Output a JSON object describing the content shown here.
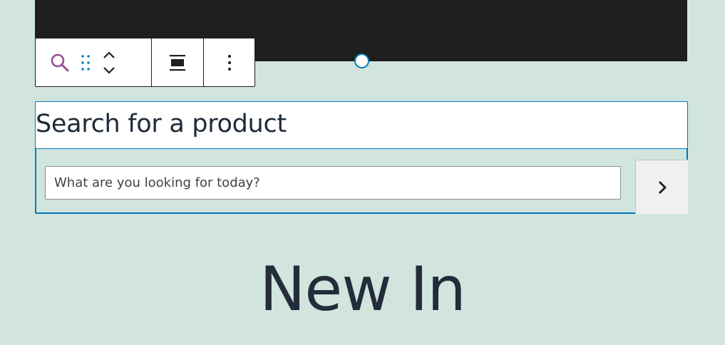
{
  "search_block": {
    "label": "Search for a product",
    "input_placeholder": "What are you looking for today?",
    "input_value": "",
    "submit_icon": "chevron-right-icon"
  },
  "toolbar": {
    "block_type_icon": "search-icon",
    "drag_icon": "drag-handle-icon",
    "move_up_icon": "chevron-up-icon",
    "move_down_icon": "chevron-down-icon",
    "align_icon": "align-wide-icon",
    "options_icon": "more-vertical-icon"
  },
  "heading": {
    "text": "New In"
  },
  "colors": {
    "background": "#d1e4de",
    "accent": "#007cba",
    "block_icon": "#9b4f96",
    "dark_block": "#1e1e1e",
    "heading_text": "#242c3b"
  }
}
